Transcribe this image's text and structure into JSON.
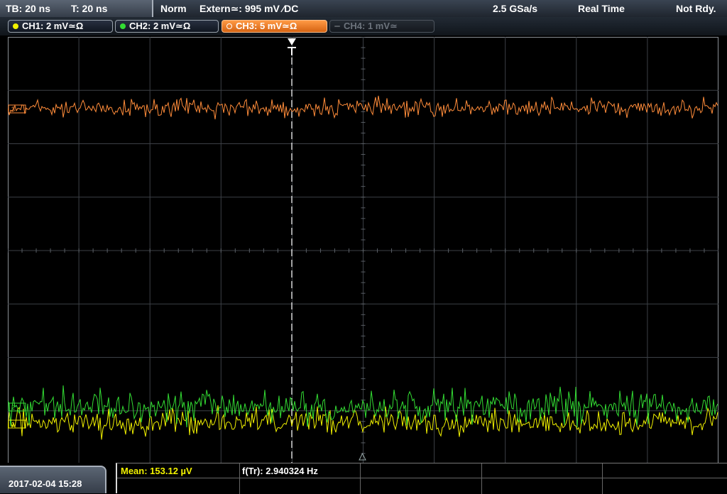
{
  "status_bar": {
    "timebase": "TB: 20 ns",
    "trigger_time": "T: 20 ns",
    "trigger_mode": "Norm",
    "trigger_source": "Extern≃: 995 mV ∕DC",
    "sample_rate": "2.5 GSa/s",
    "acquisition_mode": "Real Time",
    "run_state": "Not Rdy."
  },
  "channels": [
    {
      "label": "CH1: 2 mV≃Ω",
      "color": "#f2f200",
      "state": "on"
    },
    {
      "label": "CH2: 2 mV≃Ω",
      "color": "#33dd33",
      "state": "on"
    },
    {
      "label": "CH3: 5 mV≃Ω",
      "color": "#ff8c3a",
      "state": "selected"
    },
    {
      "label": "CH4: 1 mV≃",
      "color": "#7a7f86",
      "state": "off"
    }
  ],
  "waveforms": {
    "ch3_marker": "3",
    "ch2_marker": "2",
    "ch1_marker": "1"
  },
  "footer": {
    "datetime": "2017-02-04 15:28",
    "measurement_1": "Mean: 153.12 µV",
    "measurement_2": "f(Tr): 2.940324 Hz"
  },
  "colors": {
    "ch1": "#f2f200",
    "ch2": "#33dd33",
    "ch3": "#ff8c3a",
    "grid": "#4a4f55",
    "trigger_line": "#ffffff"
  }
}
